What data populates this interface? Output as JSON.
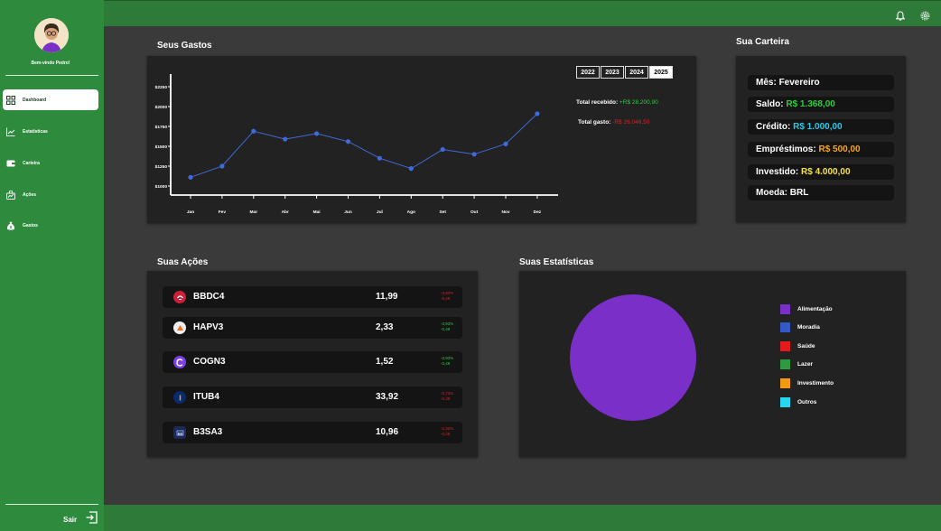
{
  "sidebar": {
    "welcome": "Bem-vindo Pedro!",
    "items": [
      {
        "label": "Dashboard",
        "icon": "dashboard-icon"
      },
      {
        "label": "Estatísticas",
        "icon": "chart-line-icon"
      },
      {
        "label": "Carteira",
        "icon": "wallet-icon"
      },
      {
        "label": "Ações",
        "icon": "stocks-icon"
      },
      {
        "label": "Gastos",
        "icon": "money-bag-icon"
      }
    ],
    "logout": "Sair"
  },
  "colors": {
    "sidebar_green": "#2e8b3e",
    "bar_green": "#2e7a38",
    "background": "#3a3a3a",
    "panel": "#222222",
    "line": "#3f6ad8",
    "positive": "#2ecc40",
    "negative": "#e02020"
  },
  "expenses": {
    "title": "Seus Gastos",
    "years": [
      "2022",
      "2023",
      "2024",
      "2025"
    ],
    "selected_year": "2025",
    "total_received_label": "Total recebido:",
    "total_received_value": "+R$ 28.200,90",
    "total_spent_label": "Total gasto:",
    "total_spent_value": "-R$ 26.046,50"
  },
  "chart_data": {
    "type": "line",
    "categories": [
      "Jan",
      "Fev",
      "Mar",
      "Abr",
      "Mai",
      "Jun",
      "Jul",
      "Ago",
      "Set",
      "Out",
      "Nov",
      "Dez"
    ],
    "series": [
      {
        "values": [
          1110,
          1250,
          1690,
          1590,
          1660,
          1560,
          1350,
          1220,
          1460,
          1400,
          1530,
          1910
        ]
      }
    ],
    "yticks": [
      "$1000",
      "$1250",
      "$1500",
      "$1750",
      "$2000",
      "$2250"
    ],
    "ylim": [
      1000,
      2250
    ],
    "title": "",
    "xlabel": "",
    "ylabel": "",
    "grid": false
  },
  "wallet": {
    "title": "Sua Carteira",
    "rows": [
      {
        "label": "Mês:",
        "value": "Fevereiro",
        "color": "#ffffff"
      },
      {
        "label": "Saldo:",
        "value": "R$ 1.368,00",
        "color": "#2ecc40"
      },
      {
        "label": "Crédito:",
        "value": "R$ 1.000,00",
        "color": "#29c7e8"
      },
      {
        "label": "Empréstimos:",
        "value": "R$ 500,00",
        "color": "#f5a623"
      },
      {
        "label": "Investido:",
        "value": "R$ 4.000,00",
        "color": "#f4e04d"
      },
      {
        "label": "Moeda:",
        "value": "BRL",
        "color": "#ffffff"
      }
    ]
  },
  "stocks": {
    "title": "Suas Ações",
    "items": [
      {
        "ticker": "BBDC4",
        "price": "11,99",
        "pct": "-3,93%",
        "abs": "-0,49",
        "color": "#e02020",
        "logo_color": "#cc1f3a"
      },
      {
        "ticker": "HAPV3",
        "price": "2,33",
        "pct": "-3,93%",
        "abs": "-0,49",
        "color": "#2ecc40",
        "logo_color": "#f0f0f0"
      },
      {
        "ticker": "COGN3",
        "price": "1,52",
        "pct": "-3,93%",
        "abs": "-0,49",
        "color": "#2ecc40",
        "logo_color": "#7b3fe4"
      },
      {
        "ticker": "ITUB4",
        "price": "33,92",
        "pct": "-0,73%",
        "abs": "-0,39",
        "color": "#e02020",
        "logo_color": "#0a2a6b"
      },
      {
        "ticker": "B3SA3",
        "price": "10,96",
        "pct": "-2,32%",
        "abs": "-0,26",
        "color": "#e02020",
        "logo_color": "#1d2a55"
      }
    ]
  },
  "statistics": {
    "title": "Suas Estatísticas",
    "legend": [
      {
        "label": "Alimentação",
        "color": "#7b2fc9"
      },
      {
        "label": "Moradia",
        "color": "#3558c7"
      },
      {
        "label": "Saúde",
        "color": "#e41b1b"
      },
      {
        "label": "Lazer",
        "color": "#2e9b3e"
      },
      {
        "label": "Investimento",
        "color": "#f59b12"
      },
      {
        "label": "Outros",
        "color": "#29d6f0"
      }
    ],
    "pie_fill": "#7b2fc9"
  }
}
